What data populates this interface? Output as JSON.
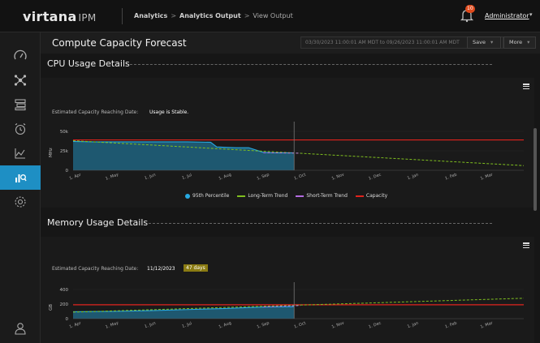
{
  "app": {
    "logo_main": "virtana",
    "logo_sub": "IPM"
  },
  "breadcrumb": {
    "items": [
      "Analytics",
      "Analytics Output",
      "View Output"
    ]
  },
  "notifications": {
    "count": "10"
  },
  "user": {
    "name": "Administrator"
  },
  "icons": {
    "sidebar": [
      "gauge-icon",
      "network-icon",
      "server-icon",
      "alarm-icon",
      "line-chart-icon",
      "analytics-icon",
      "settings-icon",
      "user-icon"
    ],
    "top": [
      "bell-icon",
      "caret-down-icon"
    ]
  },
  "colors": {
    "accent": "#1e8fc4",
    "area_fill": "#1f5f7a",
    "percentile": "#27a9e1",
    "long_term": "#7fbf1f",
    "short_term": "#b36be0",
    "capacity": "#e0231c",
    "badge": "#8a7b12"
  },
  "page": {
    "title": "Compute Capacity Forecast",
    "date_range": "03/30/2023 11:00:01 AM MDT to 09/26/2023 11:00:01 AM MDT",
    "save_label": "Save",
    "more_label": "More"
  },
  "cpu": {
    "title": "CPU Usage Details",
    "est_label": "Estimated Capacity Reaching Date:",
    "est_value": "Usage is Stable."
  },
  "memory": {
    "title": "Memory Usage Details",
    "est_label": "Estimated Capacity Reaching Date:",
    "est_value": "11/12/2023",
    "days": "47 days"
  },
  "legend": {
    "percentile": "95th Percentile",
    "long_term": "Long-Term Trend",
    "short_term": "Short-Term Trend",
    "capacity": "Capacity"
  },
  "chart_data": [
    {
      "type": "area",
      "title": "CPU Usage Details",
      "ylabel": "MHz",
      "yticks": [
        "0",
        "25k",
        "50k"
      ],
      "ylim": [
        0,
        50000
      ],
      "xticks": [
        "1. Apr",
        "1. May",
        "1. Jun",
        "1. Jul",
        "1. Aug",
        "1. Sep",
        "1. Oct",
        "1. Nov",
        "1. Dec",
        "1. Jan",
        "1. Feb",
        "1. Mar"
      ],
      "x": [
        "2023-03-30",
        "2023-04-15",
        "2023-05-01",
        "2023-05-15",
        "2023-06-01",
        "2023-06-15",
        "2023-07-01",
        "2023-07-20",
        "2023-07-25",
        "2023-08-01",
        "2023-08-10",
        "2023-08-20",
        "2023-09-01",
        "2023-09-10",
        "2023-09-26"
      ],
      "series": [
        {
          "name": "95th Percentile",
          "values": [
            37000,
            36500,
            36500,
            36500,
            36500,
            36500,
            36500,
            36000,
            30000,
            29500,
            29000,
            29000,
            23000,
            22500,
            22500
          ]
        }
      ],
      "long_term_trend": {
        "name": "Long-Term Trend",
        "x": [
          "2023-03-30",
          "2024-03-31"
        ],
        "values": [
          38000,
          6000
        ]
      },
      "short_term_trend": {
        "name": "Short-Term Trend",
        "x": [
          "2023-09-01",
          "2023-10-01"
        ],
        "values": [
          22500,
          22000
        ]
      },
      "capacity": {
        "name": "Capacity",
        "value": 39000
      },
      "now_marker": "2023-09-26",
      "legend": [
        "95th Percentile",
        "Long-Term Trend",
        "Short-Term Trend",
        "Capacity"
      ]
    },
    {
      "type": "area",
      "title": "Memory Usage Details",
      "ylabel": "GB",
      "yticks": [
        "0",
        "200",
        "400"
      ],
      "ylim": [
        0,
        400
      ],
      "xticks": [
        "1. Apr",
        "1. May",
        "1. Jun",
        "1. Jul",
        "1. Aug",
        "1. Sep",
        "1. Oct",
        "1. Nov",
        "1. Dec",
        "1. Jan",
        "1. Feb",
        "1. Mar"
      ],
      "x": [
        "2023-03-30",
        "2023-05-01",
        "2023-06-01",
        "2023-07-01",
        "2023-08-01",
        "2023-09-01",
        "2023-09-26"
      ],
      "series": [
        {
          "name": "95th Percentile",
          "values": [
            95,
            100,
            110,
            125,
            140,
            160,
            165
          ]
        }
      ],
      "long_term_trend": {
        "name": "Long-Term Trend",
        "x": [
          "2023-03-30",
          "2024-03-31"
        ],
        "values": [
          90,
          280
        ]
      },
      "short_term_trend": {
        "name": "Short-Term Trend",
        "x": [
          "2023-09-01",
          "2023-10-01"
        ],
        "values": [
          160,
          180
        ]
      },
      "capacity": {
        "name": "Capacity",
        "value": 190
      },
      "now_marker": "2023-09-26"
    }
  ]
}
